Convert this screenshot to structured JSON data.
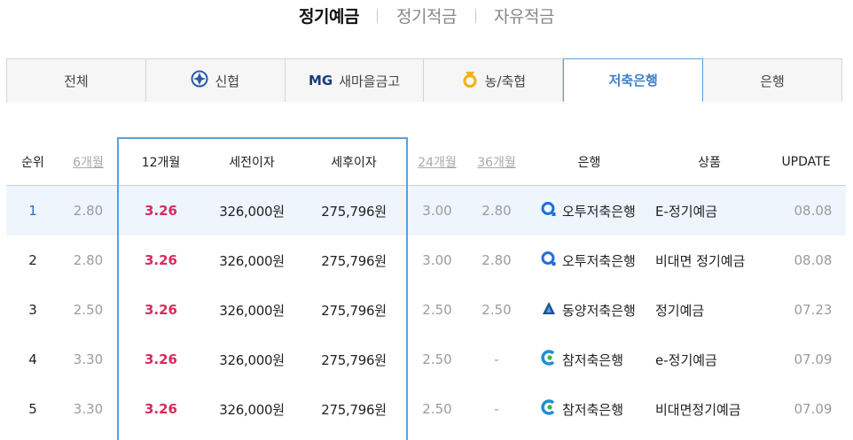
{
  "top_tabs": [
    {
      "label": "정기예금",
      "active": true
    },
    {
      "label": "정기적금",
      "active": false
    },
    {
      "label": "자유적금",
      "active": false
    }
  ],
  "category_tabs": [
    {
      "label": "전체",
      "icon": null
    },
    {
      "label": "신협",
      "icon": "shinhyup-logo-icon"
    },
    {
      "label": "새마을금고",
      "icon": "mg-logo-icon",
      "icon_text": "MG"
    },
    {
      "label": "농/축협",
      "icon": "nonghyup-logo-icon"
    },
    {
      "label": "저축은행",
      "icon": null,
      "active": true
    },
    {
      "label": "은행",
      "icon": null
    }
  ],
  "table": {
    "headers": {
      "rank": "순위",
      "m6": "6개월",
      "m12": "12개월",
      "pretax": "세전이자",
      "aftertax": "세후이자",
      "m24": "24개월",
      "m36": "36개월",
      "bank": "은행",
      "product": "상품",
      "update": "UPDATE"
    },
    "rows": [
      {
        "rank": "1",
        "m6": "2.80",
        "m12": "3.26",
        "pretax": "326,000원",
        "aftertax": "275,796원",
        "m24": "3.00",
        "m36": "2.80",
        "bank": "오투저축은행",
        "bank_icon": "o2-bank-logo-icon",
        "product": "E-정기예금",
        "update": "08.08",
        "highlight": true
      },
      {
        "rank": "2",
        "m6": "2.80",
        "m12": "3.26",
        "pretax": "326,000원",
        "aftertax": "275,796원",
        "m24": "3.00",
        "m36": "2.80",
        "bank": "오투저축은행",
        "bank_icon": "o2-bank-logo-icon",
        "product": "비대면 정기예금",
        "update": "08.08",
        "highlight": false
      },
      {
        "rank": "3",
        "m6": "2.50",
        "m12": "3.26",
        "pretax": "326,000원",
        "aftertax": "275,796원",
        "m24": "2.50",
        "m36": "2.50",
        "bank": "동양저축은행",
        "bank_icon": "dongyang-bank-logo-icon",
        "product": "정기예금",
        "update": "07.23",
        "highlight": false
      },
      {
        "rank": "4",
        "m6": "3.30",
        "m12": "3.26",
        "pretax": "326,000원",
        "aftertax": "275,796원",
        "m24": "2.50",
        "m36": "-",
        "bank": "참저축은행",
        "bank_icon": "cham-bank-logo-icon",
        "product": "e-정기예금",
        "update": "07.09",
        "highlight": false
      },
      {
        "rank": "5",
        "m6": "3.30",
        "m12": "3.26",
        "pretax": "326,000원",
        "aftertax": "275,796원",
        "m24": "2.50",
        "m36": "-",
        "bank": "참저축은행",
        "bank_icon": "cham-bank-logo-icon",
        "product": "비대면정기예금",
        "update": "07.09",
        "highlight": false
      }
    ]
  },
  "colors": {
    "accent_blue": "#5aa0dd",
    "active_tab_text": "#3d7fc7",
    "rate_highlight": "#d62b5c",
    "row_highlight_bg": "#eef5fc"
  }
}
